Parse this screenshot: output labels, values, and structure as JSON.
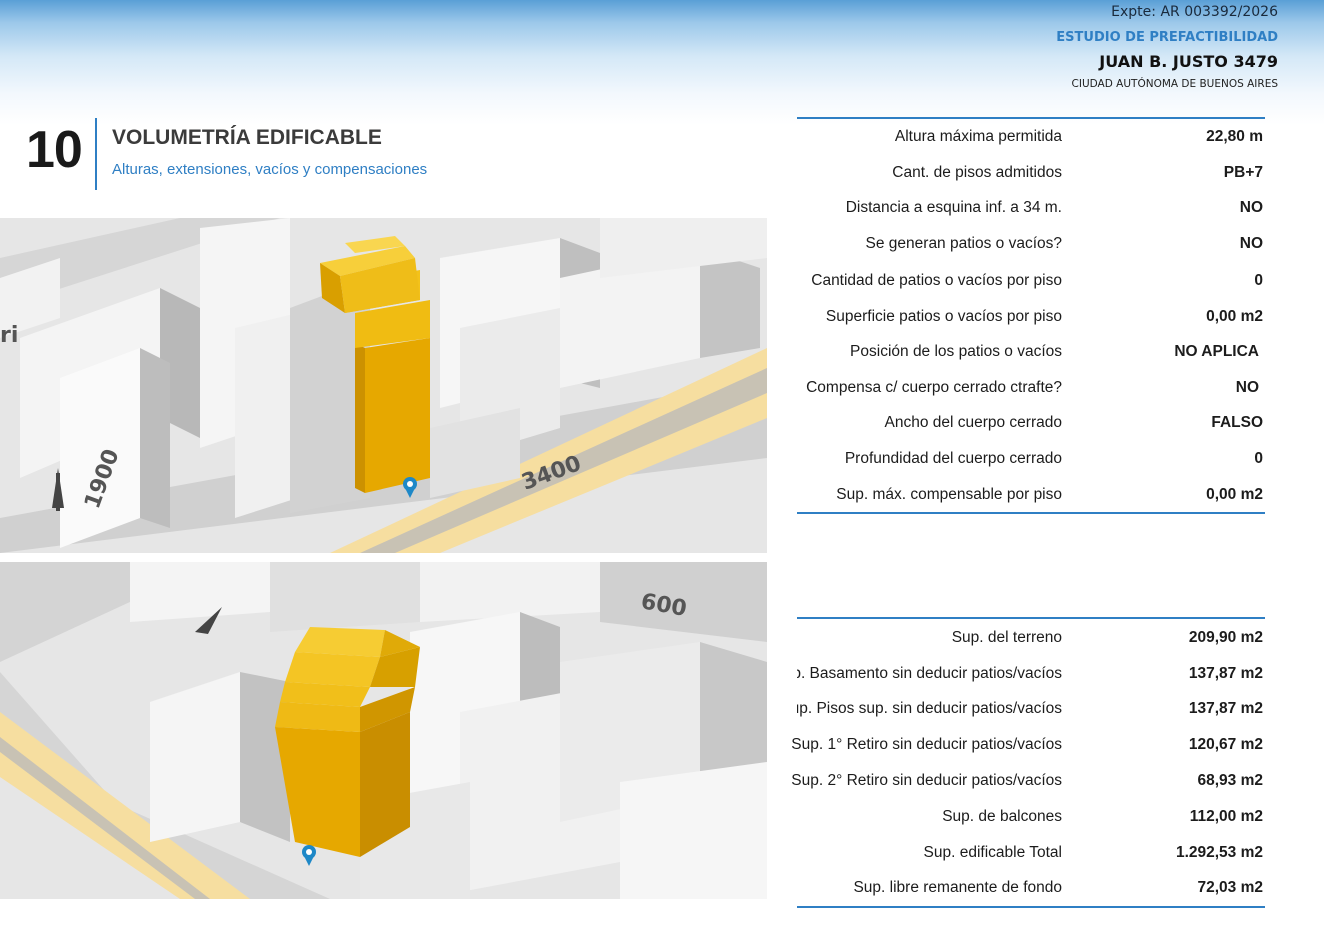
{
  "header": {
    "expte": "Expte: AR 003392/2026",
    "study": "ESTUDIO DE PREFACTIBILIDAD",
    "address": "JUAN B. JUSTO 3479",
    "city": "CIUDAD AUTÓNOMA DE BUENOS AIRES"
  },
  "section": {
    "number": "10",
    "title": "VOLUMETRÍA EDIFICABLE",
    "subtitle": "Alturas, extensiones, vacíos y compensaciones"
  },
  "map_top": {
    "street_number": "3400",
    "cross_number": "1900",
    "edge_text": "ri"
  },
  "map_bottom": {
    "edge_text": "600"
  },
  "volumetry": [
    {
      "label": "Altura máxima permitida",
      "value": "22,80 m"
    },
    {
      "label": "Cant. de pisos admitidos",
      "value": "PB+7"
    },
    {
      "label": "Distancia a esquina inf. a 34 m.",
      "value": "NO"
    },
    {
      "label": "Se generan patios o vacíos?",
      "value": "NO"
    },
    {
      "label": "Cantidad de patios o vacíos por piso",
      "value": "0"
    },
    {
      "label": "Superficie patios o vacíos por piso",
      "value": "0,00 m2"
    },
    {
      "label": "Posición de los patios o vacíos",
      "value": "NO APLICA"
    },
    {
      "label": "Compensa c/ cuerpo cerrado ctrafte?",
      "value": "NO"
    },
    {
      "label": "Ancho del  cuerpo cerrado",
      "value": "FALSO"
    },
    {
      "label": "Profundidad del  cuerpo cerrado",
      "value": "0"
    },
    {
      "label": "Sup. máx. compensable por piso",
      "value": "0,00 m2"
    }
  ],
  "surfaces": [
    {
      "label": "Sup. del terreno",
      "value": "209,90 m2"
    },
    {
      "label": "ıp. Basamento sin deducir patios/vacíos",
      "value": "137,87 m2"
    },
    {
      "label": "ıup. Pisos sup. sin deducir patios/vacíos",
      "value": "137,87 m2"
    },
    {
      "label": "Sup. 1° Retiro sin deducir patios/vacíos",
      "value": "120,67 m2"
    },
    {
      "label": "Sup. 2° Retiro sin deducir patios/vacíos",
      "value": "68,93 m2"
    },
    {
      "label": "Sup. de balcones",
      "value": "112,00 m2"
    },
    {
      "label": "Sup. edificable Total",
      "value": "1.292,53 m2"
    },
    {
      "label": "Sup. libre remanente de fondo",
      "value": "72,03 m2"
    }
  ],
  "colors": {
    "accent": "#2f7fc4",
    "volume": "#e8b400",
    "road": "#f6dea0"
  }
}
